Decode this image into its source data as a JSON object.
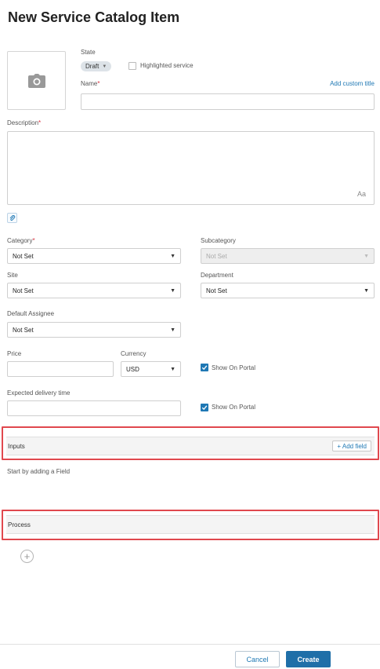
{
  "page": {
    "title": "New Service Catalog Item"
  },
  "header": {
    "state_label": "State",
    "state_value": "Draft",
    "highlighted_label": "Highlighted service",
    "name_label": "Name",
    "add_custom_title": "Add custom title"
  },
  "description": {
    "label": "Description",
    "format_glyph": "Aa"
  },
  "fields": {
    "category": {
      "label": "Category",
      "value": "Not Set"
    },
    "subcategory": {
      "label": "Subcategory",
      "value": "Not Set"
    },
    "site": {
      "label": "Site",
      "value": "Not Set"
    },
    "department": {
      "label": "Department",
      "value": "Not Set"
    },
    "assignee": {
      "label": "Default Assignee",
      "value": "Not Set"
    },
    "price": {
      "label": "Price",
      "value": ""
    },
    "currency": {
      "label": "Currency",
      "value": "USD"
    },
    "show_on_portal_price": {
      "label": "Show On Portal",
      "checked": true
    },
    "delivery": {
      "label": "Expected delivery time",
      "value": ""
    },
    "show_on_portal_delivery": {
      "label": "Show On Portal",
      "checked": true
    }
  },
  "inputs_section": {
    "title": "Inputs",
    "add_field": "+ Add field",
    "empty_text": "Start by adding a Field"
  },
  "process_section": {
    "title": "Process"
  },
  "footer": {
    "cancel": "Cancel",
    "create": "Create"
  },
  "colors": {
    "accent": "#1f78b4",
    "primary_button": "#1f6fa8",
    "required": "#d9303e",
    "highlight_border": "#e0484e"
  }
}
